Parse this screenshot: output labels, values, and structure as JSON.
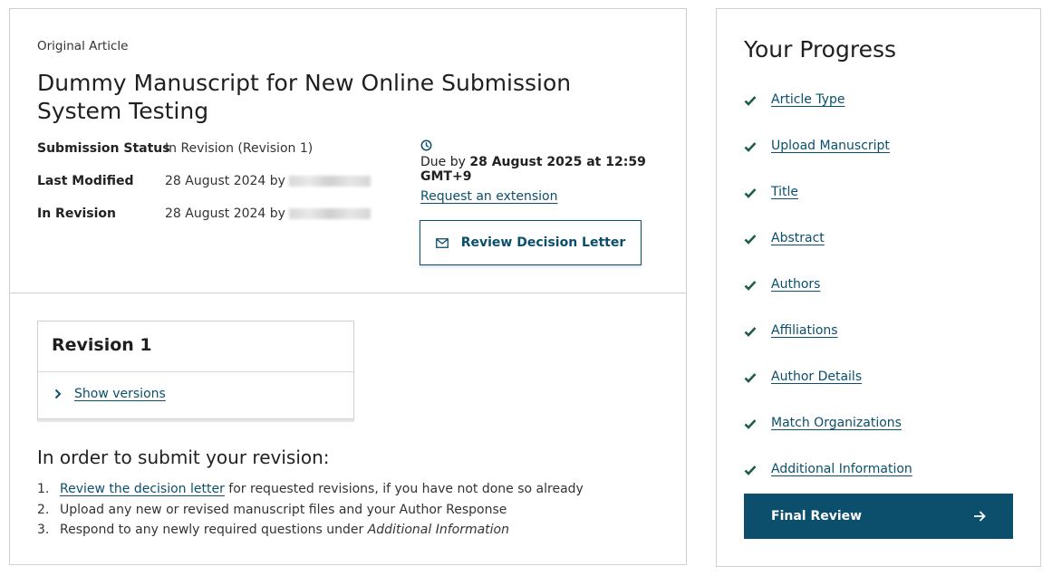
{
  "article": {
    "type": "Original Article",
    "title": "Dummy Manuscript for New Online Submission System Testing"
  },
  "meta": {
    "status_label": "Submission Status",
    "status_value": "In Revision (Revision 1)",
    "modified_label": "Last Modified",
    "modified_value": "28 August 2024 by",
    "revision_label": "In Revision",
    "revision_value": "28 August 2024 by"
  },
  "due": {
    "prefix": "Due by ",
    "date": "28 August 2025 at 12:59 GMT+9",
    "extension_link": "Request an extension",
    "review_button": "Review Decision Letter"
  },
  "revision": {
    "title": "Revision 1",
    "show_versions": "Show versions"
  },
  "instructions": {
    "heading": "In order to submit your revision:",
    "steps": [
      {
        "num": "1.",
        "link": "Review the decision letter",
        "text": " for requested revisions, if you have not done so already"
      },
      {
        "num": "2.",
        "text": "Upload any new or revised manuscript files and your Author Response"
      },
      {
        "num": "3.",
        "text": "Respond to any newly required questions under ",
        "emph": "Additional Information"
      }
    ]
  },
  "progress": {
    "title": "Your Progress",
    "items": [
      {
        "label": "Article Type"
      },
      {
        "label": "Upload Manuscript"
      },
      {
        "label": "Title"
      },
      {
        "label": "Abstract"
      },
      {
        "label": "Authors"
      },
      {
        "label": "Affiliations"
      },
      {
        "label": "Author Details"
      },
      {
        "label": "Match Organizations"
      },
      {
        "label": "Additional Information"
      }
    ],
    "final_button": "Final Review"
  },
  "colors": {
    "brand": "#0b4f6c",
    "check": "#1f5d45",
    "border": "#cfcfcf"
  }
}
